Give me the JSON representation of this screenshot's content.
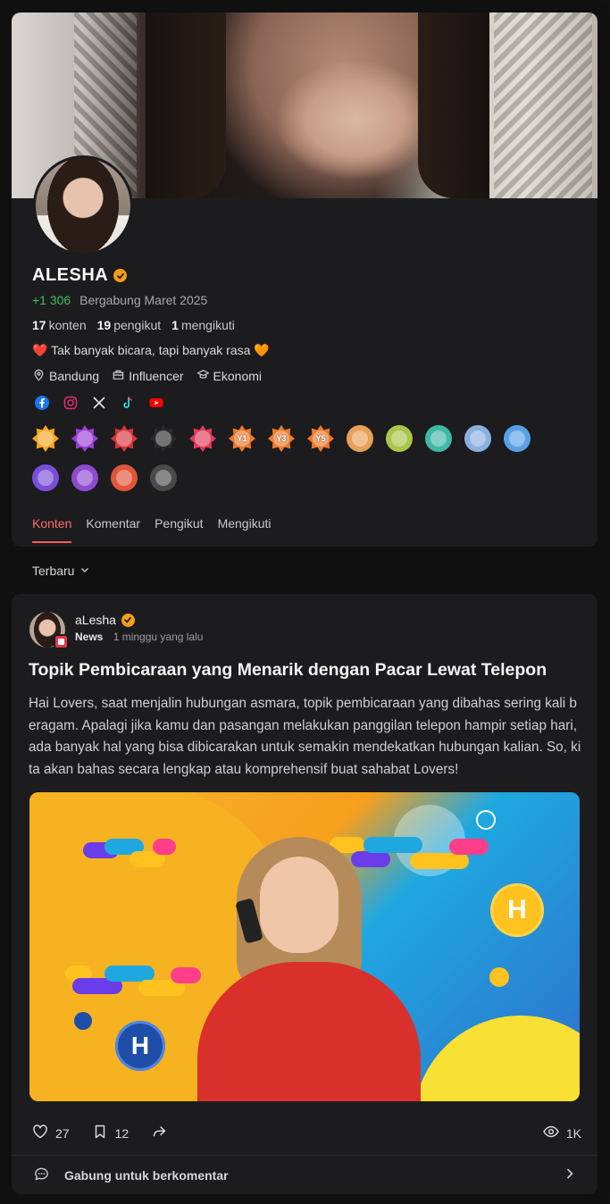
{
  "profile": {
    "name": "ALESHA",
    "points": "+1 306",
    "joined": "Bergabung Maret 2025",
    "stats": [
      {
        "value": "17",
        "label": "konten"
      },
      {
        "value": "19",
        "label": "pengikut"
      },
      {
        "value": "1",
        "label": "mengikuti"
      }
    ],
    "bio": "❤️ Tak banyak bicara, tapi banyak rasa 🧡",
    "location": "Bandung",
    "role": "Influencer",
    "category": "Ekonomi",
    "socials": [
      "facebook-icon",
      "instagram-icon",
      "x-icon",
      "tiktok-icon",
      "youtube-icon"
    ],
    "badges": [
      {
        "name": "check-badge",
        "color": "#f5a623",
        "label": ""
      },
      {
        "name": "ribbon-badge",
        "color": "#9b3fd8",
        "label": ""
      },
      {
        "name": "lightning-badge",
        "color": "#d9343a",
        "label": ""
      },
      {
        "name": "star-badge",
        "color": "#2a2a2a",
        "label": ""
      },
      {
        "name": "bug-badge",
        "color": "#e23b59",
        "label": ""
      },
      {
        "name": "year1-badge",
        "color": "#f07a2a",
        "label": "Y1"
      },
      {
        "name": "year3-badge",
        "color": "#f07a2a",
        "label": "Y3"
      },
      {
        "name": "year5-badge",
        "color": "#f07a2a",
        "label": "Y5"
      },
      {
        "name": "bronze-medal-badge",
        "color": "#e8a158",
        "label": ""
      },
      {
        "name": "green-medal-badge",
        "color": "#a9c64a",
        "label": ""
      },
      {
        "name": "teal-medal-badge",
        "color": "#3fb9a5",
        "label": ""
      },
      {
        "name": "silver-medal-badge",
        "color": "#8ab0e0",
        "label": ""
      },
      {
        "name": "blue-medal-badge",
        "color": "#5aa0e8",
        "label": ""
      },
      {
        "name": "purple-gold-badge",
        "color": "#7a4fd8",
        "label": ""
      },
      {
        "name": "purple-crown-badge",
        "color": "#8f4ad0",
        "label": ""
      },
      {
        "name": "red-gold-badge",
        "color": "#e2553a",
        "label": ""
      },
      {
        "name": "dark-crown-badge",
        "color": "#4a4a4a",
        "label": ""
      }
    ],
    "tabs": [
      "Konten",
      "Komentar",
      "Pengikut",
      "Mengikuti"
    ]
  },
  "sort": {
    "label": "Terbaru"
  },
  "post": {
    "author": "aLesha",
    "category": "News",
    "time": "1 minggu yang lalu",
    "title": "Topik Pembicaraan yang Menarik dengan Pacar Lewat Telepon",
    "excerpt": "Hai Lovers, saat menjalin hubungan asmara, topik pembicaraan yang dibahas sering kali beragam. Apalagi jika kamu dan pasangan melakukan panggilan telepon hampir setiap hari, ada banyak hal yang bisa dibicarakan untuk semakin mendekatkan hubungan kalian. So, kita akan bahas secara lengkap atau komprehensif buat sahabat Lovers!",
    "likes": "27",
    "bookmarks": "12",
    "views": "1K",
    "comment_prompt": "Gabung untuk berkomentar",
    "image_logo": "H"
  },
  "colors": {
    "background": "#111112",
    "card": "#1c1c1e",
    "accent": "#ff5a5a",
    "points": "#3cc05a",
    "verified": "#f59e1b"
  }
}
